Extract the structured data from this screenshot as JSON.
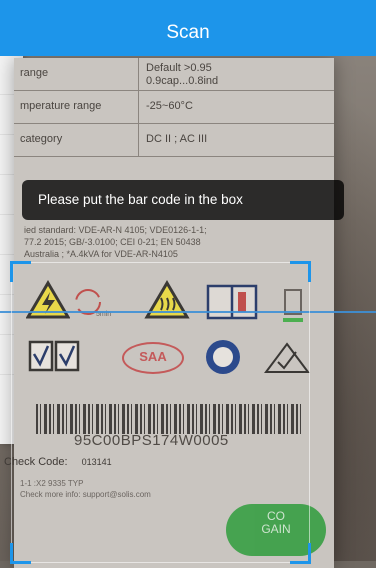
{
  "header": {
    "title": "Scan"
  },
  "tip": {
    "text": "Please put the bar code in the box"
  },
  "spec_table": [
    {
      "key": "range",
      "value": "Default >0.95\n0.9cap...0.8ind"
    },
    {
      "key": "mperature range",
      "value": "-25~60°C"
    },
    {
      "key": "category",
      "value": "DC II ; AC III"
    }
  ],
  "standards_text": "ied standard:  VDE-AR-N 4105; VDE0126-1-1;\n77.2 2015; GB/-3.0100; CEI 0-21; EN 50438\nAustralia ; *A.4kVA for VDE-AR-N4105",
  "label": {
    "serial": "95C00BPS174W0005",
    "check_code_label": "Check  Code:",
    "check_code_value": "013141",
    "saa_mark": "SAA",
    "fine_print": "1-1 :X2 9335 TYP\nCheck more info: support@solis.com"
  },
  "green_button": {
    "text": "CO\nGAIN"
  },
  "colors": {
    "header": "#1d95ea",
    "scan_line": "#3d8fd6",
    "corner": "#1d95ea"
  }
}
